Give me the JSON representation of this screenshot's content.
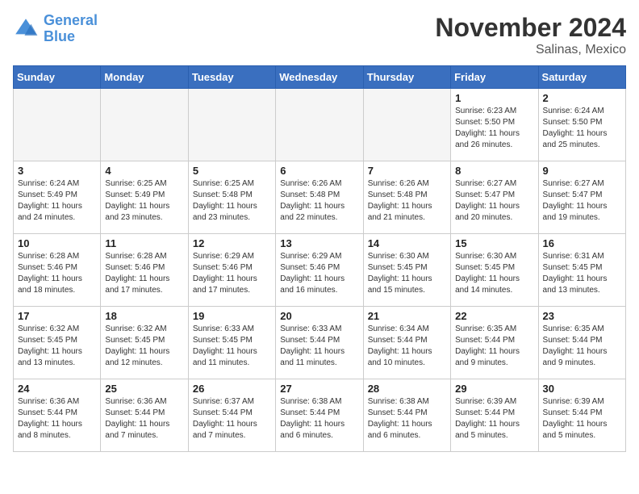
{
  "header": {
    "logo_line1": "General",
    "logo_line2": "Blue",
    "month": "November 2024",
    "location": "Salinas, Mexico"
  },
  "days_of_week": [
    "Sunday",
    "Monday",
    "Tuesday",
    "Wednesday",
    "Thursday",
    "Friday",
    "Saturday"
  ],
  "weeks": [
    [
      {
        "day": "",
        "sunrise": "",
        "sunset": "",
        "daylight": ""
      },
      {
        "day": "",
        "sunrise": "",
        "sunset": "",
        "daylight": ""
      },
      {
        "day": "",
        "sunrise": "",
        "sunset": "",
        "daylight": ""
      },
      {
        "day": "",
        "sunrise": "",
        "sunset": "",
        "daylight": ""
      },
      {
        "day": "",
        "sunrise": "",
        "sunset": "",
        "daylight": ""
      },
      {
        "day": "1",
        "sunrise": "Sunrise: 6:23 AM",
        "sunset": "Sunset: 5:50 PM",
        "daylight": "Daylight: 11 hours and 26 minutes."
      },
      {
        "day": "2",
        "sunrise": "Sunrise: 6:24 AM",
        "sunset": "Sunset: 5:50 PM",
        "daylight": "Daylight: 11 hours and 25 minutes."
      }
    ],
    [
      {
        "day": "3",
        "sunrise": "Sunrise: 6:24 AM",
        "sunset": "Sunset: 5:49 PM",
        "daylight": "Daylight: 11 hours and 24 minutes."
      },
      {
        "day": "4",
        "sunrise": "Sunrise: 6:25 AM",
        "sunset": "Sunset: 5:49 PM",
        "daylight": "Daylight: 11 hours and 23 minutes."
      },
      {
        "day": "5",
        "sunrise": "Sunrise: 6:25 AM",
        "sunset": "Sunset: 5:48 PM",
        "daylight": "Daylight: 11 hours and 23 minutes."
      },
      {
        "day": "6",
        "sunrise": "Sunrise: 6:26 AM",
        "sunset": "Sunset: 5:48 PM",
        "daylight": "Daylight: 11 hours and 22 minutes."
      },
      {
        "day": "7",
        "sunrise": "Sunrise: 6:26 AM",
        "sunset": "Sunset: 5:48 PM",
        "daylight": "Daylight: 11 hours and 21 minutes."
      },
      {
        "day": "8",
        "sunrise": "Sunrise: 6:27 AM",
        "sunset": "Sunset: 5:47 PM",
        "daylight": "Daylight: 11 hours and 20 minutes."
      },
      {
        "day": "9",
        "sunrise": "Sunrise: 6:27 AM",
        "sunset": "Sunset: 5:47 PM",
        "daylight": "Daylight: 11 hours and 19 minutes."
      }
    ],
    [
      {
        "day": "10",
        "sunrise": "Sunrise: 6:28 AM",
        "sunset": "Sunset: 5:46 PM",
        "daylight": "Daylight: 11 hours and 18 minutes."
      },
      {
        "day": "11",
        "sunrise": "Sunrise: 6:28 AM",
        "sunset": "Sunset: 5:46 PM",
        "daylight": "Daylight: 11 hours and 17 minutes."
      },
      {
        "day": "12",
        "sunrise": "Sunrise: 6:29 AM",
        "sunset": "Sunset: 5:46 PM",
        "daylight": "Daylight: 11 hours and 17 minutes."
      },
      {
        "day": "13",
        "sunrise": "Sunrise: 6:29 AM",
        "sunset": "Sunset: 5:46 PM",
        "daylight": "Daylight: 11 hours and 16 minutes."
      },
      {
        "day": "14",
        "sunrise": "Sunrise: 6:30 AM",
        "sunset": "Sunset: 5:45 PM",
        "daylight": "Daylight: 11 hours and 15 minutes."
      },
      {
        "day": "15",
        "sunrise": "Sunrise: 6:30 AM",
        "sunset": "Sunset: 5:45 PM",
        "daylight": "Daylight: 11 hours and 14 minutes."
      },
      {
        "day": "16",
        "sunrise": "Sunrise: 6:31 AM",
        "sunset": "Sunset: 5:45 PM",
        "daylight": "Daylight: 11 hours and 13 minutes."
      }
    ],
    [
      {
        "day": "17",
        "sunrise": "Sunrise: 6:32 AM",
        "sunset": "Sunset: 5:45 PM",
        "daylight": "Daylight: 11 hours and 13 minutes."
      },
      {
        "day": "18",
        "sunrise": "Sunrise: 6:32 AM",
        "sunset": "Sunset: 5:45 PM",
        "daylight": "Daylight: 11 hours and 12 minutes."
      },
      {
        "day": "19",
        "sunrise": "Sunrise: 6:33 AM",
        "sunset": "Sunset: 5:45 PM",
        "daylight": "Daylight: 11 hours and 11 minutes."
      },
      {
        "day": "20",
        "sunrise": "Sunrise: 6:33 AM",
        "sunset": "Sunset: 5:44 PM",
        "daylight": "Daylight: 11 hours and 11 minutes."
      },
      {
        "day": "21",
        "sunrise": "Sunrise: 6:34 AM",
        "sunset": "Sunset: 5:44 PM",
        "daylight": "Daylight: 11 hours and 10 minutes."
      },
      {
        "day": "22",
        "sunrise": "Sunrise: 6:35 AM",
        "sunset": "Sunset: 5:44 PM",
        "daylight": "Daylight: 11 hours and 9 minutes."
      },
      {
        "day": "23",
        "sunrise": "Sunrise: 6:35 AM",
        "sunset": "Sunset: 5:44 PM",
        "daylight": "Daylight: 11 hours and 9 minutes."
      }
    ],
    [
      {
        "day": "24",
        "sunrise": "Sunrise: 6:36 AM",
        "sunset": "Sunset: 5:44 PM",
        "daylight": "Daylight: 11 hours and 8 minutes."
      },
      {
        "day": "25",
        "sunrise": "Sunrise: 6:36 AM",
        "sunset": "Sunset: 5:44 PM",
        "daylight": "Daylight: 11 hours and 7 minutes."
      },
      {
        "day": "26",
        "sunrise": "Sunrise: 6:37 AM",
        "sunset": "Sunset: 5:44 PM",
        "daylight": "Daylight: 11 hours and 7 minutes."
      },
      {
        "day": "27",
        "sunrise": "Sunrise: 6:38 AM",
        "sunset": "Sunset: 5:44 PM",
        "daylight": "Daylight: 11 hours and 6 minutes."
      },
      {
        "day": "28",
        "sunrise": "Sunrise: 6:38 AM",
        "sunset": "Sunset: 5:44 PM",
        "daylight": "Daylight: 11 hours and 6 minutes."
      },
      {
        "day": "29",
        "sunrise": "Sunrise: 6:39 AM",
        "sunset": "Sunset: 5:44 PM",
        "daylight": "Daylight: 11 hours and 5 minutes."
      },
      {
        "day": "30",
        "sunrise": "Sunrise: 6:39 AM",
        "sunset": "Sunset: 5:44 PM",
        "daylight": "Daylight: 11 hours and 5 minutes."
      }
    ]
  ]
}
